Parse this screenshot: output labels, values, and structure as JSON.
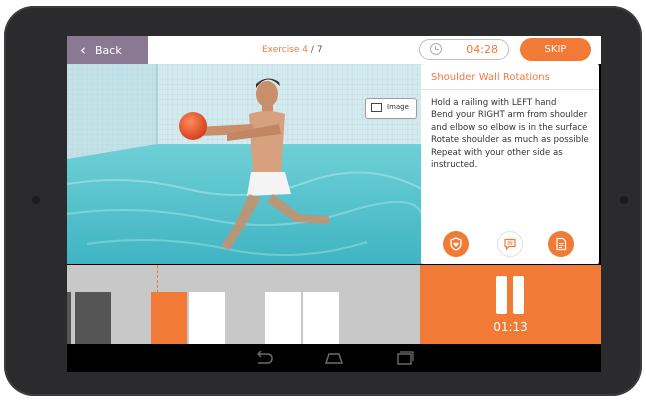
{
  "header": {
    "back_label": "Back",
    "exercise_prefix": "Exercise 4",
    "exercise_total": "/ 7",
    "timer": "04:28",
    "skip_label": "SKIP"
  },
  "scene": {
    "image_button_label": "Image"
  },
  "exercise_info": {
    "title": "Shoulder Wall Rotations",
    "steps": [
      "Hold a railing with LEFT hand",
      "Bend your RIGHT arm from shoulder and elbow so elbow is in the surface",
      "Rotate shoulder as much as possible",
      "Repeat with your other side as instructed."
    ],
    "action_icons": [
      "heart-shield-icon",
      "comment-icon",
      "document-icon"
    ]
  },
  "playback": {
    "elapsed": "01:13"
  },
  "colors": {
    "accent": "#f07a36",
    "back_bar": "#8a7992",
    "timeline_bg": "#c8c8c8",
    "water": "#5cc6cf"
  },
  "system_nav": [
    "back-icon",
    "home-icon",
    "recents-icon"
  ]
}
